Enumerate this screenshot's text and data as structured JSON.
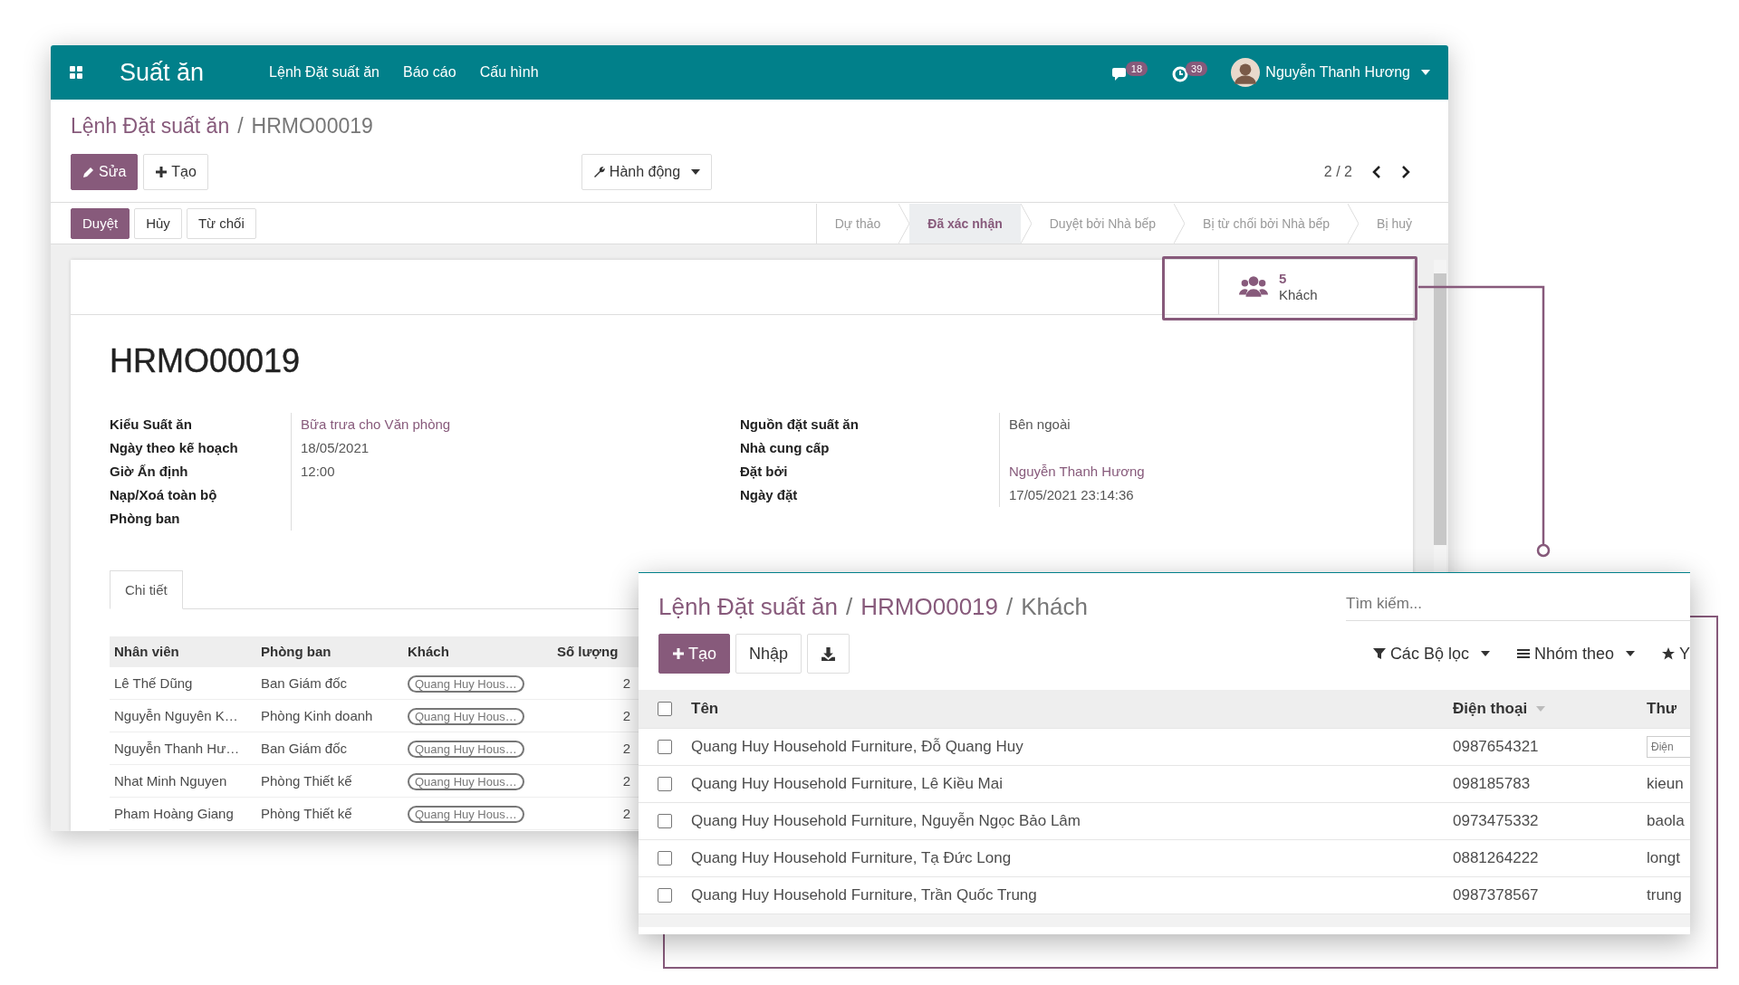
{
  "app": {
    "title": "Suất ăn",
    "menu": [
      "Lệnh Đặt suất ăn",
      "Báo cáo",
      "Cấu hình"
    ],
    "messages_count": "18",
    "activities_count": "39",
    "user": "Nguyễn Thanh Hương"
  },
  "form": {
    "breadcrumb": [
      "Lệnh Đặt suất ăn",
      "HRMO00019"
    ],
    "breadcrumb_separator": "/",
    "edit_button": "Sửa",
    "create_button": "Tạo",
    "action_button": "Hành động",
    "pager": "2 / 2",
    "header_buttons": [
      {
        "label": "Duyệt",
        "primary": true
      },
      {
        "label": "Hủy",
        "primary": false
      },
      {
        "label": "Từ chối",
        "primary": false
      }
    ],
    "stages": [
      {
        "label": "Dự thảo",
        "selected": false
      },
      {
        "label": "Đã xác nhận",
        "selected": true
      },
      {
        "label": "Duyệt bởi Nhà bếp",
        "selected": false
      },
      {
        "label": "Bị từ chối bởi Nhà bếp",
        "selected": false
      },
      {
        "label": "Bị huỷ",
        "selected": false
      }
    ],
    "smart_button": {
      "count": "5",
      "label": "Khách"
    },
    "record_name": "HRMO00019",
    "left_fields": [
      {
        "label": "Kiểu Suất ăn",
        "value": "Bữa trưa cho Văn phòng",
        "link": true
      },
      {
        "label": "Ngày theo kế hoạch",
        "value": "18/05/2021",
        "link": false
      },
      {
        "label": "Giờ Ấn định",
        "value": "12:00",
        "link": false
      },
      {
        "label": "Nạp/Xoá toàn bộ Phòng ban"
      }
    ],
    "right_fields": [
      {
        "label": "Nguồn đặt suất ăn",
        "value": "Bên ngoài",
        "link": false
      },
      {
        "label": "Nhà cung cấp"
      },
      {
        "label": "Đặt bởi",
        "value": "Nguyễn Thanh Hương",
        "link": true
      },
      {
        "label": "Ngày đặt",
        "value": "17/05/2021 23:14:36",
        "link": false
      }
    ],
    "tabs": [
      {
        "label": "Chi tiết",
        "selected": true
      }
    ],
    "lines": {
      "columns": [
        "Nhân viên",
        "Phòng ban",
        "Khách",
        "Số lượng"
      ],
      "rows": [
        {
          "employee": "Lê Thế Dũng",
          "department": "Ban Giám đốc",
          "guest": "Quang Huy Hous…",
          "quantity": "2"
        },
        {
          "employee": "Nguyễn Nguyên K…",
          "department": "Phòng Kinh doanh",
          "guest": "Quang Huy Hous…",
          "quantity": "2"
        },
        {
          "employee": "Nguyễn Thanh Hư…",
          "department": "Ban Giám đốc",
          "guest": "Quang Huy Hous…",
          "quantity": "2"
        },
        {
          "employee": "Nhat Minh Nguyen",
          "department": "Phòng Thiết kế",
          "guest": "Quang Huy Hous…",
          "quantity": "2"
        },
        {
          "employee": "Pham Hoàng Giang",
          "department": "Phòng Thiết kế",
          "guest": "Quang Huy Hous…",
          "quantity": "2"
        }
      ]
    }
  },
  "guests": {
    "breadcrumb": [
      "Lệnh Đặt suất ăn",
      "HRMO00019",
      "Khách"
    ],
    "breadcrumb_separators": [
      "/",
      "/"
    ],
    "select_all_checked": false,
    "search": {
      "placeholder": "Tìm kiếm..."
    },
    "create_button": "Tạo",
    "import_button": "Nhập",
    "filters": [
      "Các Bộ lọc",
      "Nhóm theo"
    ],
    "favorites": "Y",
    "columns": [
      "Tên",
      "Điện thoại",
      "Thư"
    ],
    "rows": [
      {
        "name": "Quang Huy Household Furniture, Đỗ Quang Huy",
        "phone": "0987654321",
        "column_3_placeholder": "Điện",
        "checked": false
      },
      {
        "name": "Quang Huy Household Furniture, Lê Kiều Mai",
        "phone": "098185783",
        "column_3": "kieun",
        "checked": false
      },
      {
        "name": "Quang Huy Household Furniture, Nguyễn Ngọc Bảo Lâm",
        "phone": "0973475332",
        "column_3": "baola",
        "checked": false
      },
      {
        "name": "Quang Huy Household Furniture, Tạ Đức Long",
        "phone": "0881264222",
        "column_3": "longt",
        "checked": false
      },
      {
        "name": "Quang Huy Household Furniture, Trần Quốc Trung",
        "phone": "0987378567",
        "column_3": "trung",
        "checked": false
      }
    ]
  }
}
